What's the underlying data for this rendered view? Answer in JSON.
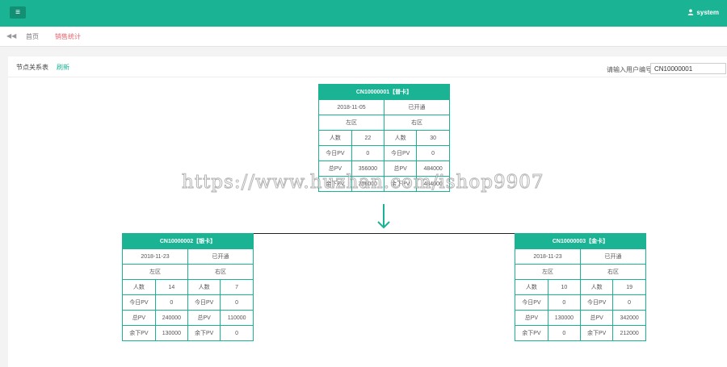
{
  "header": {
    "menu_icon": "hamburger-icon",
    "user_name": "system"
  },
  "tabs": {
    "back_icon": "double-chevron-left-icon",
    "home": "首页",
    "active": "销售统计"
  },
  "panel": {
    "title": "节点关系表",
    "refresh": "刷新",
    "search_label": "请输入用户编号",
    "search_value": "CN10000001"
  },
  "nodes": {
    "root": {
      "title": "CN10000001【普卡】",
      "date": "2018-11-05",
      "status": "已开通",
      "left_zone": "左区",
      "right_zone": "右区",
      "rows": [
        [
          "人数",
          "22",
          "人数",
          "30"
        ],
        [
          "今日PV",
          "0",
          "今日PV",
          "0"
        ],
        [
          "总PV",
          "356000",
          "总PV",
          "484000"
        ],
        [
          "余下PV",
          "356000",
          "余下PV",
          "484000"
        ]
      ]
    },
    "left": {
      "title": "CN10000002【银卡】",
      "date": "2018-11-23",
      "status": "已开通",
      "left_zone": "左区",
      "right_zone": "右区",
      "rows": [
        [
          "人数",
          "14",
          "人数",
          "7"
        ],
        [
          "今日PV",
          "0",
          "今日PV",
          "0"
        ],
        [
          "总PV",
          "240000",
          "总PV",
          "110000"
        ],
        [
          "余下PV",
          "130000",
          "余下PV",
          "0"
        ]
      ]
    },
    "right": {
      "title": "CN10000003【金卡】",
      "date": "2018-11-23",
      "status": "已开通",
      "left_zone": "左区",
      "right_zone": "右区",
      "rows": [
        [
          "人数",
          "10",
          "人数",
          "19"
        ],
        [
          "今日PV",
          "0",
          "今日PV",
          "0"
        ],
        [
          "总PV",
          "130000",
          "总PV",
          "342000"
        ],
        [
          "余下PV",
          "0",
          "余下PV",
          "212000"
        ]
      ]
    }
  },
  "watermark": "https://www.huzhan.com/ishop9907",
  "colors": {
    "accent": "#1ab394",
    "active_tab": "#e4606d"
  }
}
